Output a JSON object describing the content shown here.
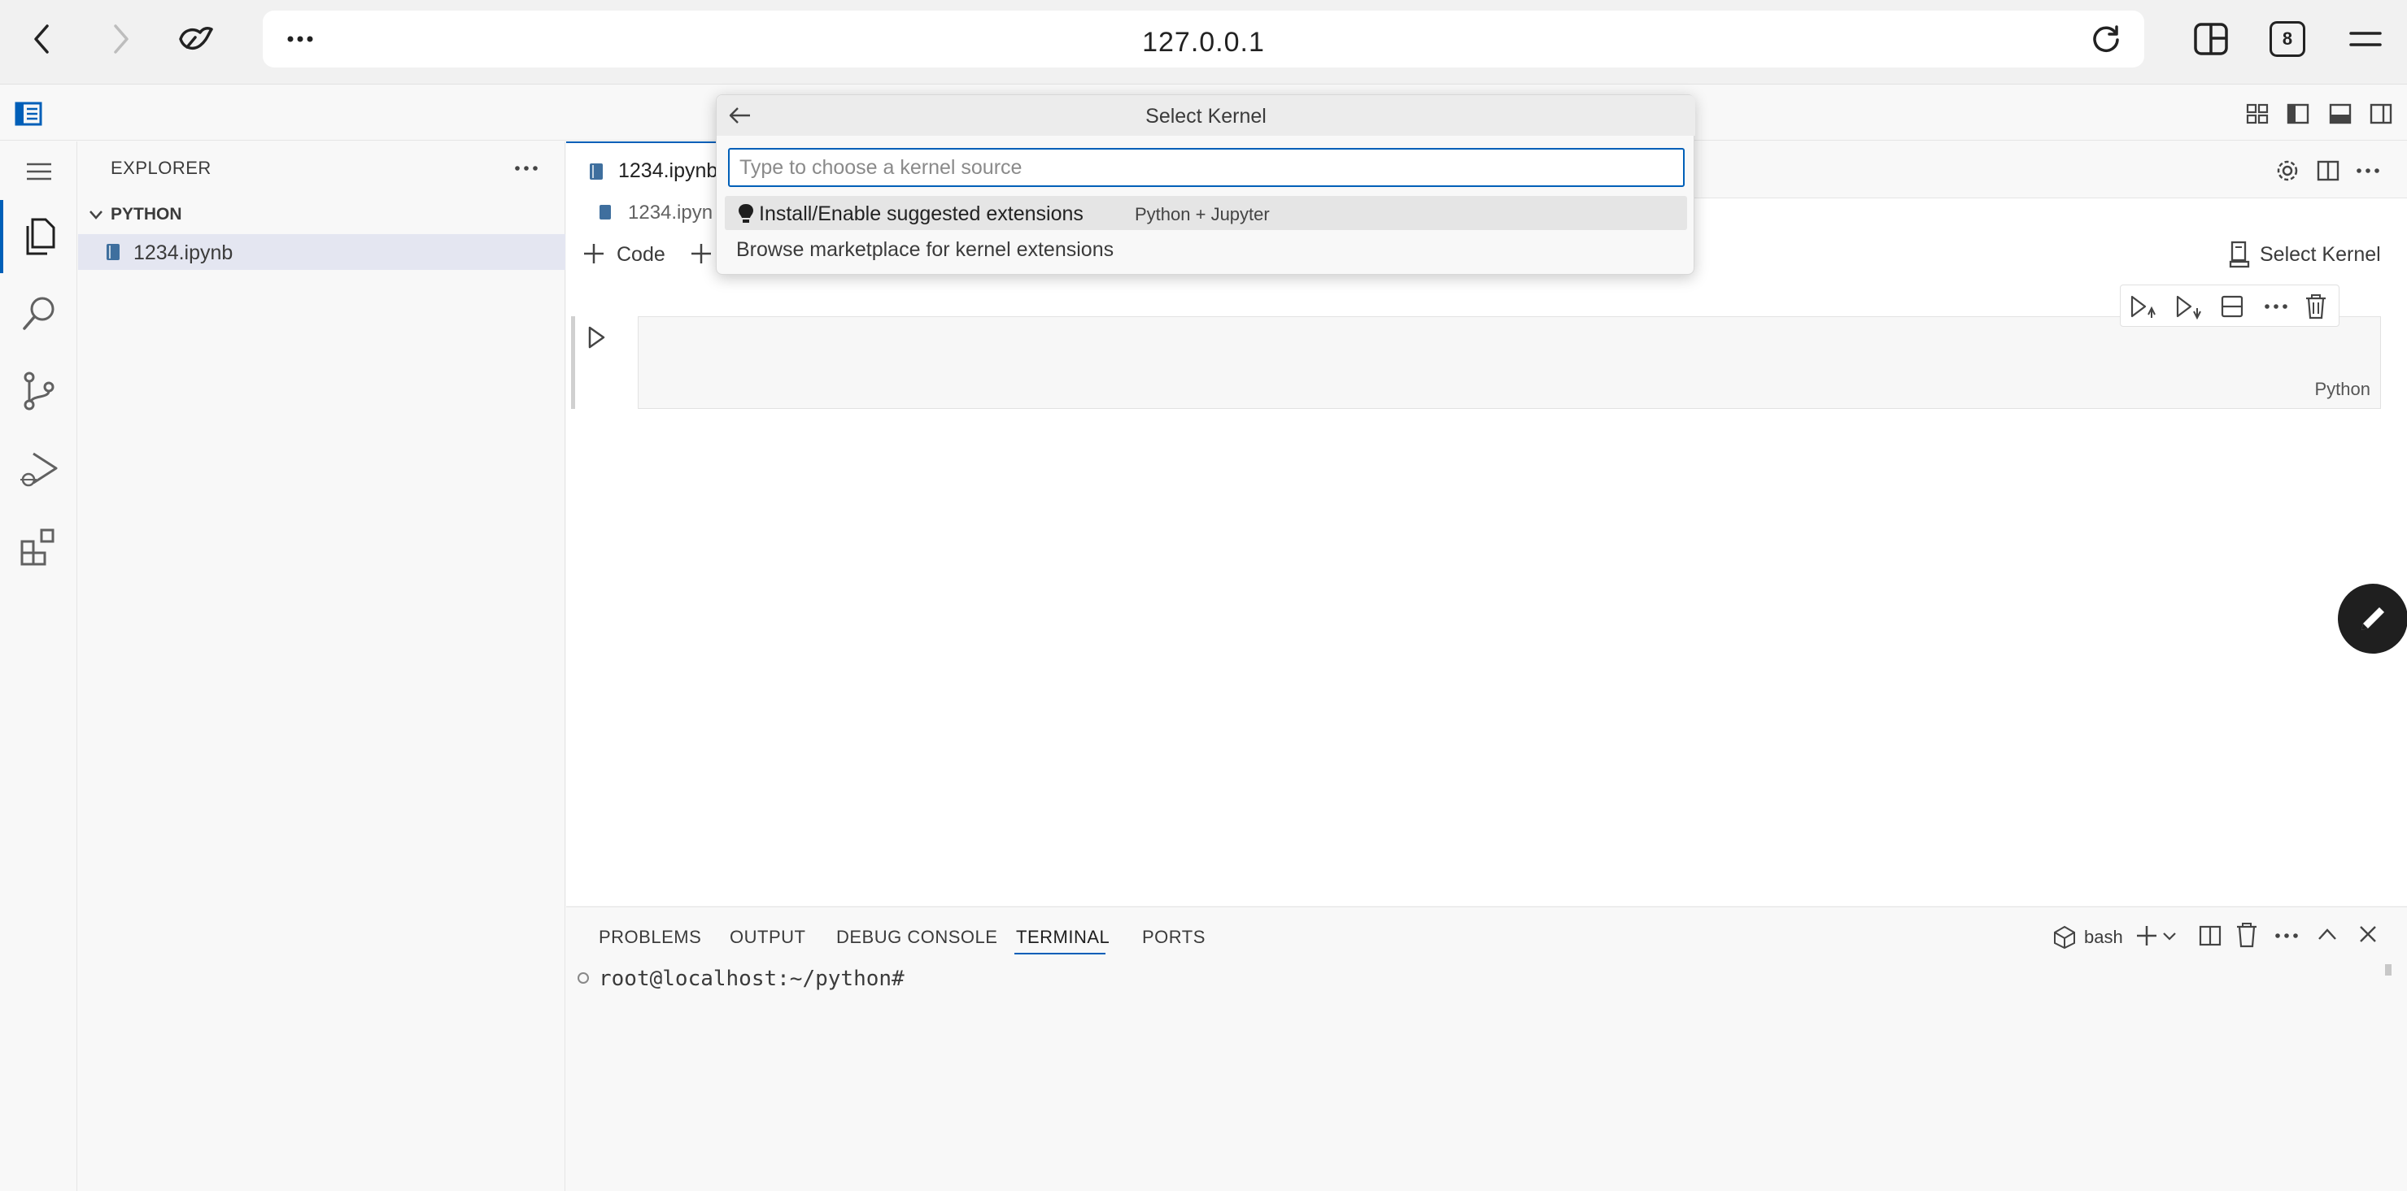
{
  "browser": {
    "url": "127.0.0.1",
    "tab_count": "8"
  },
  "sidebar": {
    "title": "EXPLORER",
    "folder": "PYTHON",
    "files": [
      "1234.ipynb"
    ]
  },
  "editor": {
    "tab_label": "1234.ipynb",
    "breadcrumb": "1234.ipyn",
    "add_code_label": "Code",
    "select_kernel_label": "Select Kernel",
    "cell_language": "Python"
  },
  "quick_pick": {
    "title": "Select Kernel",
    "input_placeholder": "Type to choose a kernel source",
    "input_value": "",
    "items": [
      {
        "label": "Install/Enable suggested extensions",
        "description": "Python + Jupyter"
      },
      {
        "label": "Browse marketplace for kernel extensions",
        "description": ""
      }
    ]
  },
  "panel": {
    "tabs": [
      "PROBLEMS",
      "OUTPUT",
      "DEBUG CONSOLE",
      "TERMINAL",
      "PORTS"
    ],
    "active_tab": "TERMINAL",
    "shell_label": "bash",
    "terminal_prompt": "root@localhost:~/python#"
  },
  "colors": {
    "accent": "#005fb8",
    "background": "#f8f8f8"
  }
}
